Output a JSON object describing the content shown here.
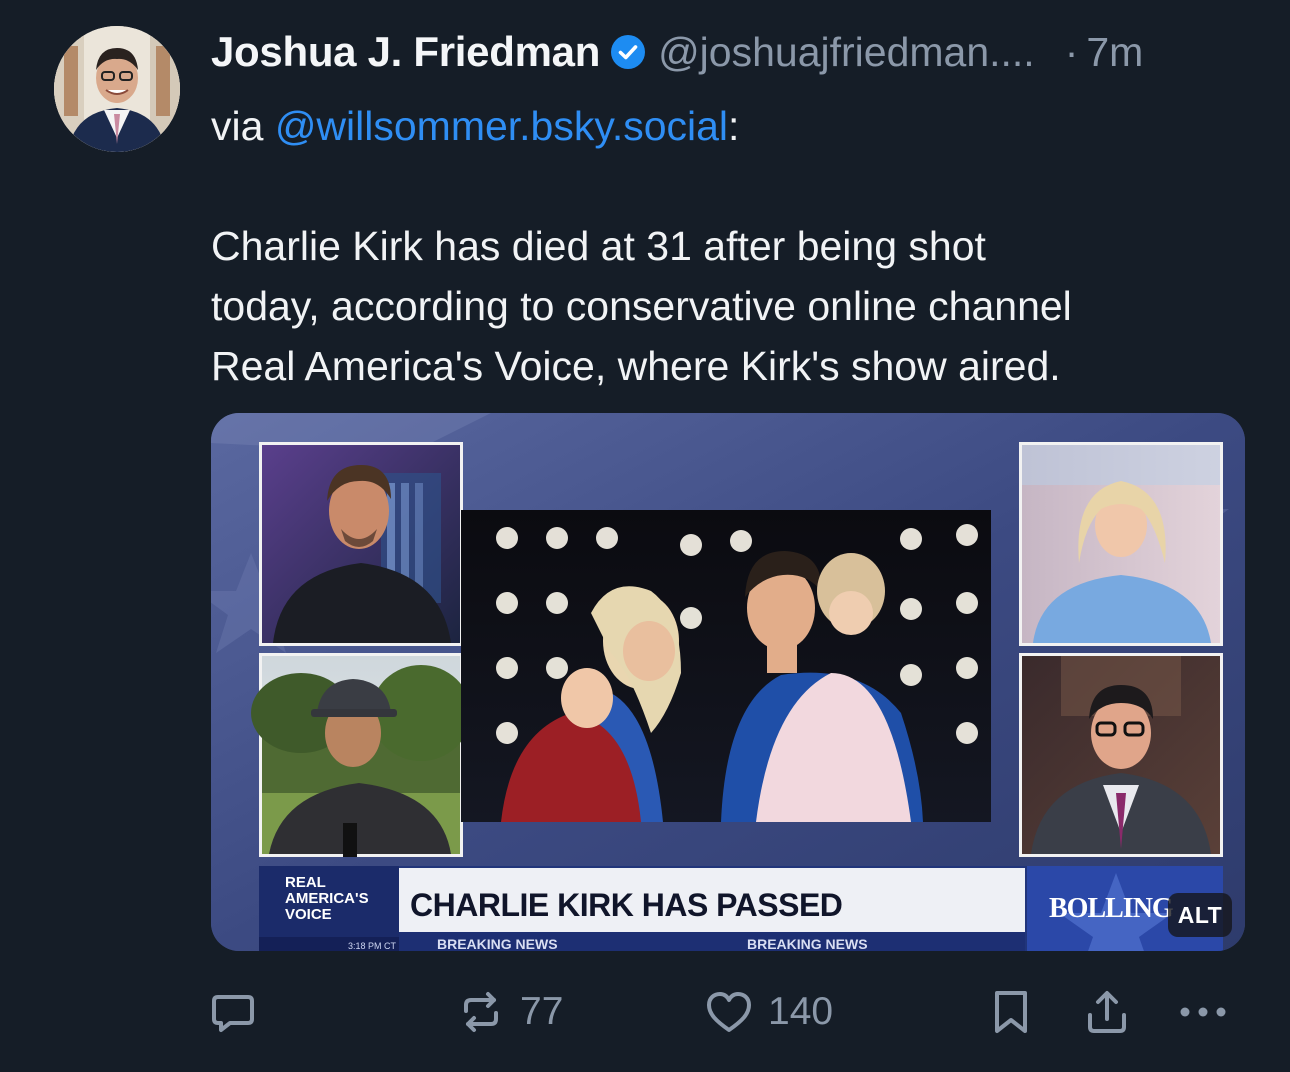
{
  "post": {
    "author_name": "Joshua J. Friedman",
    "handle": "@joshuajfriedman....",
    "time_separator": "·",
    "timestamp": "7m",
    "via_prefix": "via ",
    "via_mention": "@willsommer.bsky.social",
    "via_suffix": ":",
    "text_lines": [
      "Charlie Kirk has died at 31 after being shot",
      "today, according to conservative online channel",
      "Real America's Voice, where Kirk's show aired."
    ]
  },
  "media": {
    "alt_badge": "ALT",
    "network_logo": [
      "REAL",
      "AMERICA'S",
      "VOICE"
    ],
    "clock_text": "3:18 PM CT",
    "headline": "CHARLIE KIRK HAS PASSED",
    "ticker_left": "BREAKING NEWS",
    "ticker_right": "BREAKING NEWS",
    "show_logo": "BOLLING"
  },
  "actions": {
    "reply_icon": "reply-icon",
    "repost_icon": "repost-icon",
    "repost_count": "77",
    "like_icon": "heart-icon",
    "like_count": "140",
    "bookmark_icon": "bookmark-icon",
    "share_icon": "share-icon",
    "more_icon": "more-icon"
  },
  "colors": {
    "background": "#151d27",
    "text": "#f1f3f5",
    "muted": "#8b98a9",
    "link": "#2f8ef4",
    "verified": "#1d8cf2"
  }
}
